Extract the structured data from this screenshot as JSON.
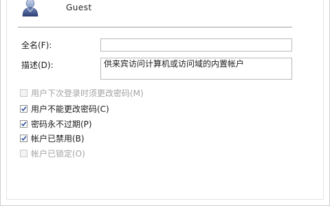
{
  "user": {
    "icon": "user-icon",
    "name": "Guest"
  },
  "form": {
    "fullname": {
      "label": "全名(F):",
      "value": ""
    },
    "description": {
      "label": "描述(D):",
      "value": "供来宾访问计算机或访问域的内置帐户"
    }
  },
  "options": [
    {
      "label": "用户下次登录时须更改密码(M)",
      "checked": false,
      "enabled": false
    },
    {
      "label": "用户不能更改密码(C)",
      "checked": true,
      "enabled": true
    },
    {
      "label": "密码永不过期(P)",
      "checked": true,
      "enabled": true
    },
    {
      "label": "帐户已禁用(B)",
      "checked": true,
      "enabled": true
    },
    {
      "label": "帐户已锁定(O)",
      "checked": false,
      "enabled": false
    }
  ],
  "colors": {
    "checkmark": "#2b4a9c",
    "disabled_text": "#a2a2a2",
    "separator": "#a0a0a0"
  }
}
